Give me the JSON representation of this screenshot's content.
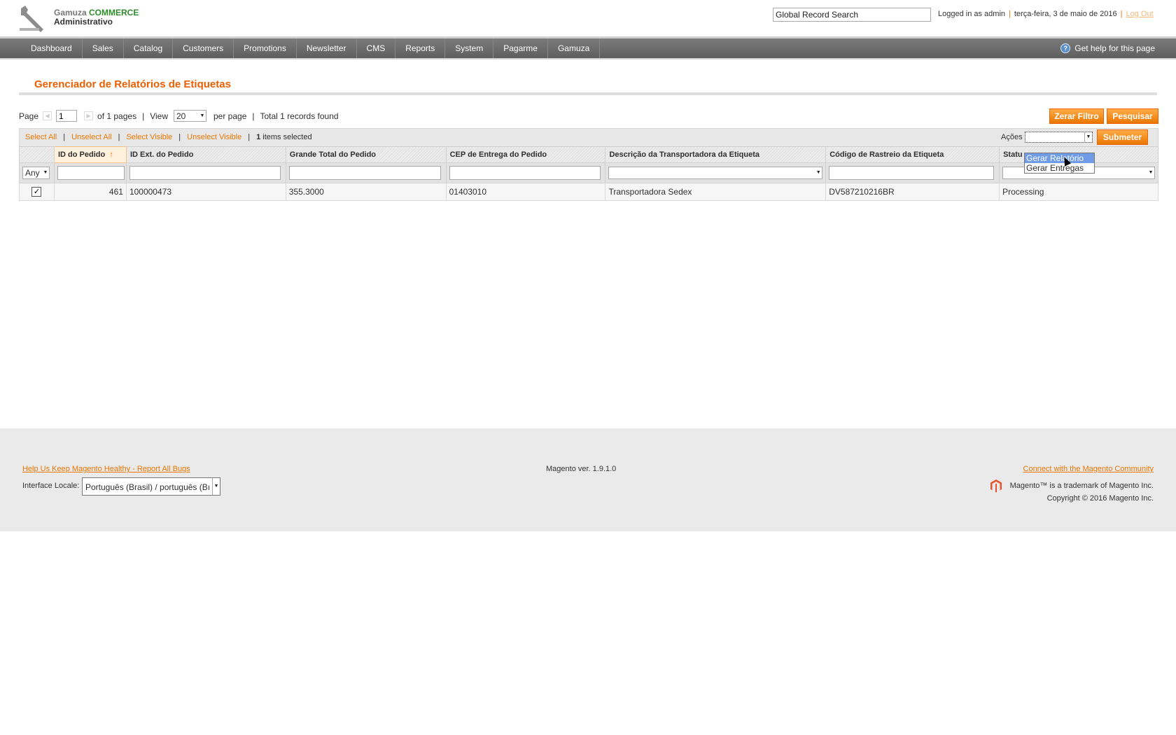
{
  "header": {
    "logo_line1_prefix": "Gamuza ",
    "logo_line1_brand": "COMMERCE",
    "logo_line2": "Administrativo",
    "global_search_placeholder": "Global Record Search",
    "logged_in": "Logged in as admin",
    "date": "terça-feira, 3 de maio de 2016",
    "logout": "Log Out"
  },
  "nav": {
    "items": [
      "Dashboard",
      "Sales",
      "Catalog",
      "Customers",
      "Promotions",
      "Newsletter",
      "CMS",
      "Reports",
      "System",
      "Pagarme",
      "Gamuza"
    ],
    "help": "Get help for this page"
  },
  "page": {
    "title": "Gerenciador de Relatórios de Etiquetas"
  },
  "pager": {
    "page_label": "Page",
    "page_value": "1",
    "of_pages": "of 1 pages",
    "view_label": "View",
    "per_page_value": "20",
    "per_page_label": "per page",
    "total": "Total 1 records found",
    "reset_filter": "Zerar Filtro",
    "search": "Pesquisar"
  },
  "massaction": {
    "select_all": "Select All",
    "unselect_all": "Unselect All",
    "select_visible": "Select Visible",
    "unselect_visible": "Unselect Visible",
    "selected_count": "1",
    "selected_label": " items selected",
    "actions_label": "Ações",
    "submit": "Submeter",
    "options": [
      "Gerar Relatório",
      "Gerar Entregas"
    ]
  },
  "grid": {
    "columns": [
      "ID do Pedido",
      "ID Ext. do Pedido",
      "Grande Total do Pedido",
      "CEP de Entrega do Pedido",
      "Descrição da Transportadora da Etiqueta",
      "Código de Rastreio da Etiqueta",
      "Statu"
    ],
    "filter_any": "Any",
    "rows": [
      {
        "id": "461",
        "ext_id": "100000473",
        "grand_total": "355.3000",
        "cep": "01403010",
        "carrier": "Transportadora Sedex",
        "tracking": "DV587210216BR",
        "status": "Processing"
      }
    ]
  },
  "footer": {
    "report_bugs": "Help Us Keep Magento Healthy - Report All Bugs",
    "locale_label": "Interface Locale:",
    "locale_value": "Português (Brasil) / português (Bı",
    "version": "Magento ver. 1.9.1.0",
    "community": "Connect with the Magento Community",
    "trademark": "Magento™ is a trademark of Magento Inc.",
    "copyright": "Copyright © 2016 Magento Inc."
  },
  "colors": {
    "accent": "#ea7601",
    "title": "#eb5e00",
    "nav": "#6a6a6a"
  }
}
